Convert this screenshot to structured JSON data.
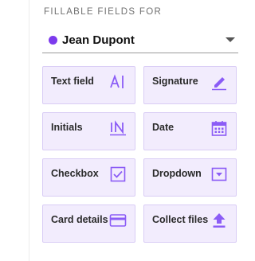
{
  "section_title": "FILLABLE FIELDS FOR",
  "recipient": {
    "name": "Jean Dupont",
    "color": "#7c3aed"
  },
  "accent_color": "#8b5cf6",
  "fields": [
    {
      "label": "Text field",
      "icon": "text-field-icon"
    },
    {
      "label": "Signature",
      "icon": "pen-icon"
    },
    {
      "label": "Initials",
      "icon": "initials-icon"
    },
    {
      "label": "Date",
      "icon": "calendar-icon"
    },
    {
      "label": "Checkbox",
      "icon": "checkbox-icon"
    },
    {
      "label": "Dropdown",
      "icon": "dropdown-icon"
    },
    {
      "label": "Card details",
      "icon": "credit-card-icon"
    },
    {
      "label": "Collect files",
      "icon": "upload-icon"
    }
  ]
}
